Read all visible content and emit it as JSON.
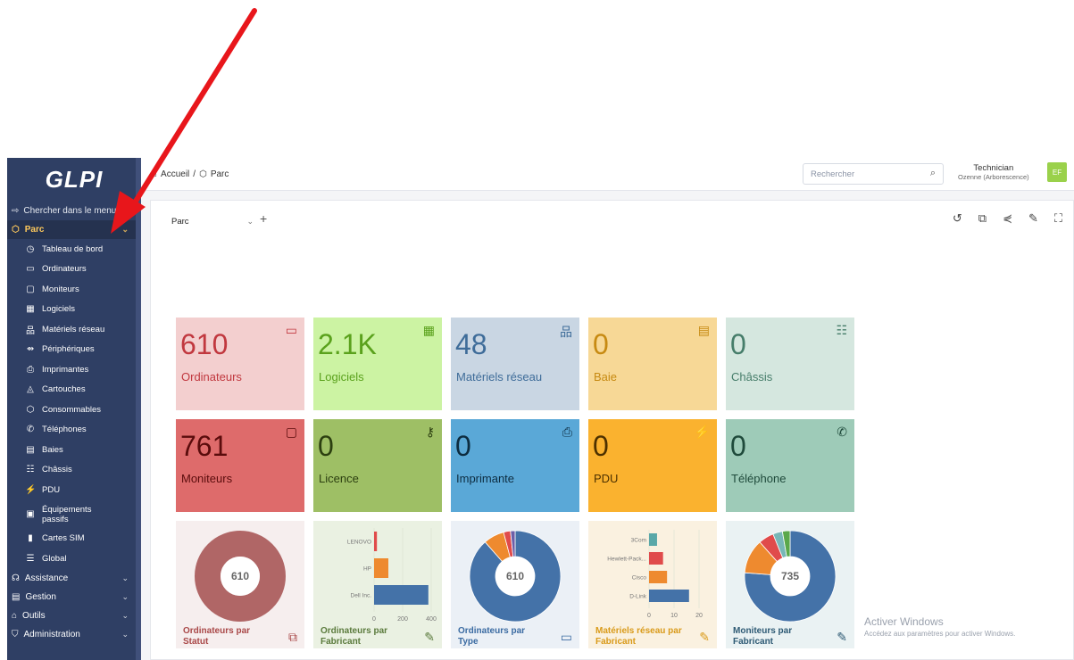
{
  "app": {
    "logo": "GLPI"
  },
  "sidebar": {
    "search_label": "Chercher dans le menu",
    "active_section": "Parc",
    "items": [
      {
        "label": "Tableau de bord",
        "icon": "dashboard-icon",
        "glyph": "◷"
      },
      {
        "label": "Ordinateurs",
        "icon": "laptop-icon",
        "glyph": "▭"
      },
      {
        "label": "Moniteurs",
        "icon": "monitor-icon",
        "glyph": "▢"
      },
      {
        "label": "Logiciels",
        "icon": "apps-icon",
        "glyph": "▦"
      },
      {
        "label": "Matériels réseau",
        "icon": "network-icon",
        "glyph": "品"
      },
      {
        "label": "Périphériques",
        "icon": "usb-icon",
        "glyph": "⇴"
      },
      {
        "label": "Imprimantes",
        "icon": "printer-icon",
        "glyph": "⎙"
      },
      {
        "label": "Cartouches",
        "icon": "droplet-icon",
        "glyph": "◬"
      },
      {
        "label": "Consommables",
        "icon": "package-icon",
        "glyph": "⬡"
      },
      {
        "label": "Téléphones",
        "icon": "phone-icon",
        "glyph": "✆"
      },
      {
        "label": "Baies",
        "icon": "server-icon",
        "glyph": "▤"
      },
      {
        "label": "Châssis",
        "icon": "chassis-icon",
        "glyph": "☷"
      },
      {
        "label": "PDU",
        "icon": "plug-icon",
        "glyph": "⚡"
      },
      {
        "label": "Équipements passifs",
        "icon": "passive-icon",
        "glyph": "▣"
      },
      {
        "label": "Cartes SIM",
        "icon": "sim-icon",
        "glyph": "▮"
      },
      {
        "label": "Global",
        "icon": "list-icon",
        "glyph": "☰"
      }
    ],
    "bottom_sections": [
      {
        "label": "Assistance",
        "icon": "headset-icon",
        "glyph": "☊"
      },
      {
        "label": "Gestion",
        "icon": "wallet-icon",
        "glyph": "▤"
      },
      {
        "label": "Outils",
        "icon": "briefcase-icon",
        "glyph": "⌂"
      },
      {
        "label": "Administration",
        "icon": "shield-icon",
        "glyph": "⛉"
      }
    ]
  },
  "topbar": {
    "breadcrumb_home": "Accueil",
    "breadcrumb_sep": "/",
    "breadcrumb_current": "Parc",
    "search_placeholder": "Rechercher",
    "user_role": "Technician",
    "user_entity": "Ozenne (Arborescence)",
    "avatar_initials": "EF"
  },
  "dashboard": {
    "selected": "Parc",
    "add_label": "+",
    "tiles": [
      {
        "value": "610",
        "label": "Ordinateurs",
        "bg": "#f3cfcf",
        "fg": "#c1383f",
        "icon": "laptop-icon",
        "glyph": "▭"
      },
      {
        "value": "2.1K",
        "label": "Logiciels",
        "bg": "#ccf3a3",
        "fg": "#5aa11c",
        "icon": "apps-add-icon",
        "glyph": "▦"
      },
      {
        "value": "48",
        "label": "Matériels réseau",
        "bg": "#c9d6e3",
        "fg": "#3e6c99",
        "icon": "network-icon",
        "glyph": "品"
      },
      {
        "value": "0",
        "label": "Baie",
        "bg": "#f7d896",
        "fg": "#c78a12",
        "icon": "server-icon",
        "glyph": "▤"
      },
      {
        "value": "0",
        "label": "Châssis",
        "bg": "#d5e7df",
        "fg": "#467d6a",
        "icon": "chassis-icon",
        "glyph": "☷"
      },
      {
        "value": "761",
        "label": "Moniteurs",
        "bg": "#de6b6b",
        "fg": "#5a0c0c",
        "icon": "monitor-icon",
        "glyph": "▢"
      },
      {
        "value": "0",
        "label": "Licence",
        "bg": "#9ebf65",
        "fg": "#2c3f10",
        "icon": "key-icon",
        "glyph": "⚷"
      },
      {
        "value": "0",
        "label": "Imprimante",
        "bg": "#5aa8d7",
        "fg": "#0d2c40",
        "icon": "printer-icon",
        "glyph": "⎙"
      },
      {
        "value": "0",
        "label": "PDU",
        "bg": "#fab22f",
        "fg": "#4d3100",
        "icon": "plug-icon",
        "glyph": "⚡"
      },
      {
        "value": "0",
        "label": "Téléphone",
        "bg": "#9ecbb8",
        "fg": "#1f4a3b",
        "icon": "phone-icon",
        "glyph": "✆"
      }
    ],
    "chart_tiles": [
      {
        "title": "Ordinateurs par Statut",
        "bg": "#f6eeee",
        "fg": "#a94848",
        "icon": "hierarchy-icon",
        "glyph": "⧉"
      },
      {
        "title": "Ordinateurs par Fabricant",
        "bg": "#eaf1e2",
        "fg": "#5a7a3c",
        "icon": "edit-icon",
        "glyph": "✎"
      },
      {
        "title": "Ordinateurs par Type",
        "bg": "#ebf0f6",
        "fg": "#3b6ba2",
        "icon": "laptop-icon",
        "glyph": "▭"
      },
      {
        "title": "Matériels réseau par Fabricant",
        "bg": "#faf1e0",
        "fg": "#d99a19",
        "icon": "edit-icon",
        "glyph": "✎"
      },
      {
        "title": "Moniteurs par Fabricant",
        "bg": "#eaf2f3",
        "fg": "#2e5a74",
        "icon": "edit-icon",
        "glyph": "✎"
      }
    ]
  },
  "chart_data": [
    {
      "type": "pie",
      "title": "Ordinateurs par Statut",
      "center_label": "610",
      "slices": [
        {
          "value": 610,
          "color": "#b06666"
        }
      ]
    },
    {
      "type": "bar",
      "orientation": "horizontal",
      "title": "Ordinateurs par Fabricant",
      "categories": [
        "LENOVO",
        "HP",
        "Dell Inc."
      ],
      "values": [
        20,
        100,
        380
      ],
      "colors": [
        "#e04b4b",
        "#ee8a2f",
        "#4472a8"
      ],
      "xticks": [
        "0",
        "200",
        "400"
      ],
      "xlim": [
        0,
        400
      ]
    },
    {
      "type": "pie",
      "title": "Ordinateurs par Type",
      "center_label": "610",
      "slices": [
        {
          "value": 540,
          "color": "#4472a8"
        },
        {
          "value": 45,
          "color": "#ee8a2f"
        },
        {
          "value": 15,
          "color": "#e04b4b"
        },
        {
          "value": 10,
          "color": "#6c5fa8"
        }
      ]
    },
    {
      "type": "bar",
      "orientation": "horizontal",
      "title": "Matériels réseau par Fabricant",
      "categories": [
        "3Com",
        "Hewlett-Pack...",
        "Cisco",
        "D-Link"
      ],
      "values": [
        4,
        7,
        9,
        20
      ],
      "colors": [
        "#5aa8a8",
        "#e04b4b",
        "#ee8a2f",
        "#4472a8"
      ],
      "xticks": [
        "0",
        "10",
        "20"
      ],
      "xlim": [
        0,
        25
      ]
    },
    {
      "type": "pie",
      "title": "Moniteurs par Fabricant",
      "center_label": "735",
      "slices": [
        {
          "value": 560,
          "color": "#4472a8"
        },
        {
          "value": 90,
          "color": "#ee8a2f"
        },
        {
          "value": 40,
          "color": "#e04b4b"
        },
        {
          "value": 25,
          "color": "#78b7b7"
        },
        {
          "value": 20,
          "color": "#5aa84a"
        }
      ]
    }
  ],
  "watermark": {
    "title": "Activer Windows",
    "subtitle": "Accédez aux paramètres pour activer Windows."
  }
}
